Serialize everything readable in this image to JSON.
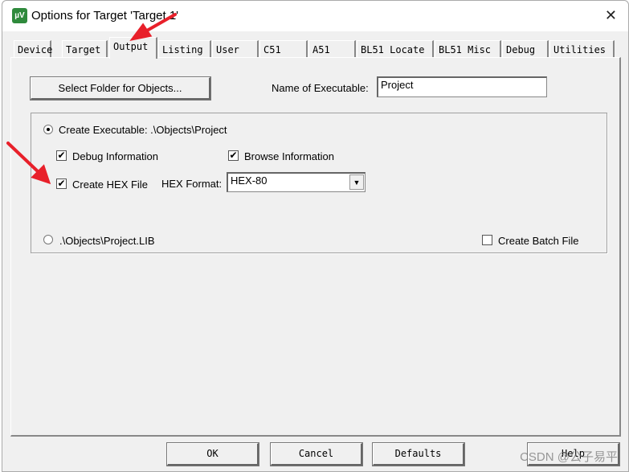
{
  "window": {
    "title": "Options for Target 'Target 1'",
    "close_icon": "close-icon",
    "app_icon": "uvision-icon"
  },
  "tabs": [
    {
      "label": "Device"
    },
    {
      "label": "Target"
    },
    {
      "label": "Output",
      "active": true
    },
    {
      "label": "Listing"
    },
    {
      "label": "User"
    },
    {
      "label": "C51"
    },
    {
      "label": "A51"
    },
    {
      "label": "BL51 Locate"
    },
    {
      "label": "BL51 Misc"
    },
    {
      "label": "Debug"
    },
    {
      "label": "Utilities"
    }
  ],
  "output": {
    "select_folder_label": "Select Folder for Objects...",
    "name_exec_label": "Name of Executable:",
    "name_exec_value": "Project",
    "create_exec_label": "Create Executable:  .\\Objects\\Project",
    "create_exec_selected": true,
    "debug_info_label": "Debug Information",
    "debug_info_checked": true,
    "browse_info_label": "Browse Information",
    "browse_info_checked": true,
    "create_hex_label": "Create HEX File",
    "create_hex_checked": true,
    "hex_format_label": "HEX Format:",
    "hex_format_value": "HEX-80",
    "create_lib_label": ".\\Objects\\Project.LIB",
    "create_lib_selected": false,
    "batch_label": "Create Batch File",
    "batch_checked": false
  },
  "buttons": {
    "ok": "OK",
    "cancel": "Cancel",
    "defaults": "Defaults",
    "help": "Help"
  },
  "watermark": "CSDN @公子易平",
  "annotation_color": "#e8202a"
}
